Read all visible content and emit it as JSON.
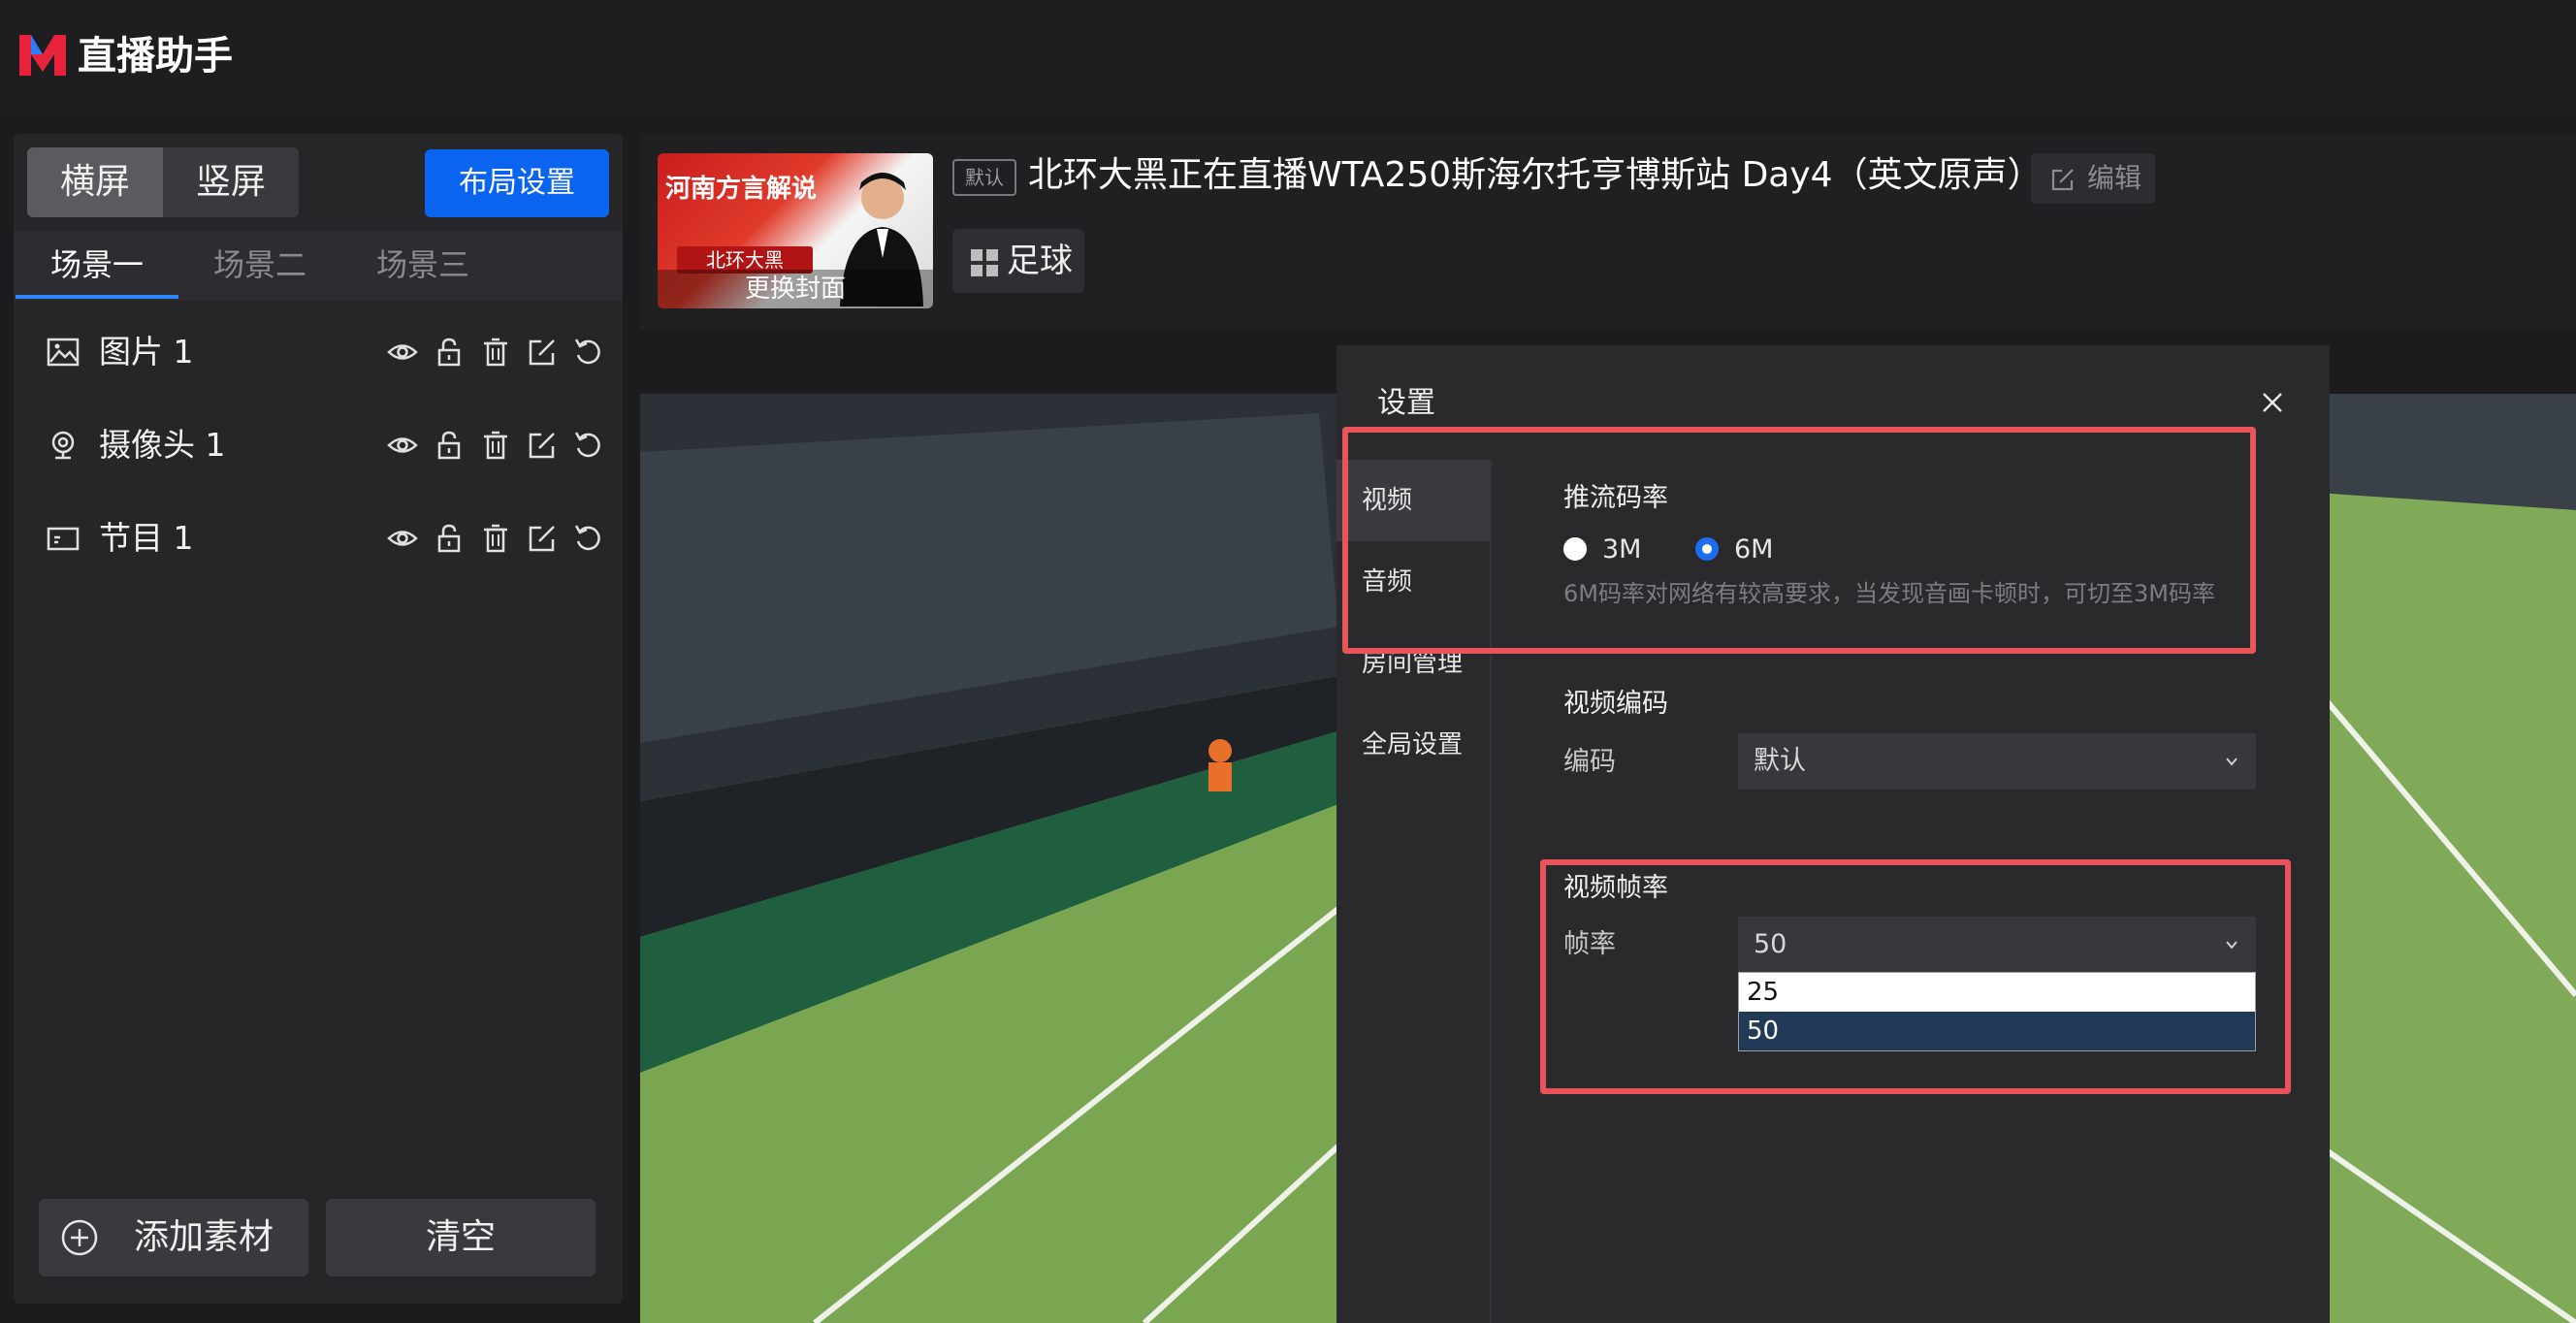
{
  "app": {
    "logo_text": "直播助手",
    "brand_color": "#e8223a",
    "accent_color": "#0a64f0"
  },
  "left_panel": {
    "orientation": {
      "horizontal": "横屏",
      "vertical": "竖屏",
      "selected": "横屏"
    },
    "layout_button": "布局设置",
    "scene_tabs": [
      "场景一",
      "场景二",
      "场景三"
    ],
    "active_scene": "场景一",
    "layers": [
      {
        "label": "图片 1",
        "icon": "image-icon"
      },
      {
        "label": "摄像头 1",
        "icon": "camera-icon"
      },
      {
        "label": "节目 1",
        "icon": "program-icon"
      }
    ],
    "layer_tool_icons": [
      "eye-icon",
      "unlock-icon",
      "trash-icon",
      "edit-icon",
      "refresh-icon"
    ],
    "add_button": "添加素材",
    "clear_button": "清空"
  },
  "stream": {
    "cover": {
      "headline": "河南方言解说",
      "badge": "北环大黑",
      "change_label": "更换封面"
    },
    "default_badge": "默认",
    "title": "北环大黑正在直播WTA250斯海尔托亨博斯站 Day4（英文原声）",
    "edit_label": "编辑",
    "category": "足球"
  },
  "settings_dialog": {
    "title": "设置",
    "nav": [
      "视频",
      "音频",
      "房间管理",
      "全局设置"
    ],
    "active_nav": "视频",
    "bitrate": {
      "title": "推流码率",
      "options": [
        "3M",
        "6M"
      ],
      "selected": "6M",
      "hint": "6M码率对网络有较高要求，当发现音画卡顿时，可切至3M码率"
    },
    "encoding": {
      "title": "视频编码",
      "label": "编码",
      "value": "默认"
    },
    "framerate": {
      "title": "视频帧率",
      "label": "帧率",
      "value": "50",
      "options": [
        "25",
        "50"
      ],
      "highlighted": "50"
    },
    "highlight_color": "#e8545a"
  }
}
